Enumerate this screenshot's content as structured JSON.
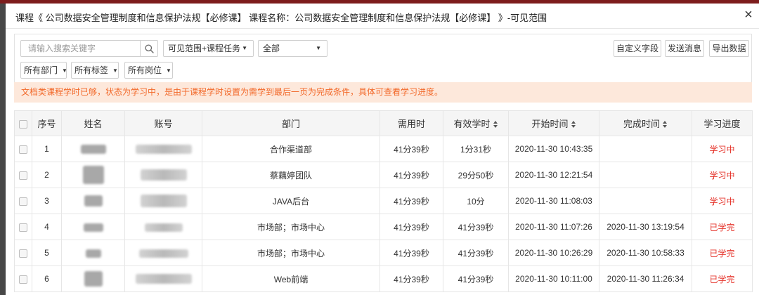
{
  "dialog": {
    "title": "课程《 公司数据安全管理制度和信息保护法规【必修课】 课程名称：公司数据安全管理制度和信息保护法规【必修课】 》-可见范围",
    "close_glyph": "×"
  },
  "filters": {
    "search": {
      "placeholder": "请输入搜索关键字",
      "value": ""
    },
    "scope_select": "可见范围+课程任务",
    "status_select": "全部",
    "department_select": "所有部门",
    "tag_select": "所有标签",
    "position_select": "所有岗位",
    "caret_glyph": "▼"
  },
  "actions": {
    "custom_fields": "自定义字段",
    "send_message": "发送消息",
    "export": "导出数据"
  },
  "notice": "文档类课程学时已够，状态为学习中，是由于课程学时设置为需学到最后一页为完成条件，具体可查看学习进度。",
  "table": {
    "select_all": false,
    "columns": [
      {
        "label": "序号",
        "sortable": false
      },
      {
        "label": "姓名",
        "sortable": false
      },
      {
        "label": "账号",
        "sortable": false
      },
      {
        "label": "部门",
        "sortable": false
      },
      {
        "label": "需用时",
        "sortable": false
      },
      {
        "label": "有效学时",
        "sortable": true
      },
      {
        "label": "开始时间",
        "sortable": true
      },
      {
        "label": "完成时间",
        "sortable": true
      },
      {
        "label": "学习进度",
        "sortable": false
      }
    ],
    "rows": [
      {
        "checked": false,
        "seq": "1",
        "dept": "合作渠道部",
        "required_time": "41分39秒",
        "effective_time": "1分31秒",
        "start_time": "2020-11-30 10:43:35",
        "finish_time": "",
        "progress": "学习中"
      },
      {
        "checked": false,
        "seq": "2",
        "dept": "蔡藕婷团队",
        "required_time": "41分39秒",
        "effective_time": "29分50秒",
        "start_time": "2020-11-30 12:21:54",
        "finish_time": "",
        "progress": "学习中"
      },
      {
        "checked": false,
        "seq": "3",
        "dept": "JAVA后台",
        "required_time": "41分39秒",
        "effective_time": "10分",
        "start_time": "2020-11-30 11:08:03",
        "finish_time": "",
        "progress": "学习中"
      },
      {
        "checked": false,
        "seq": "4",
        "dept": "市场部；市场中心",
        "required_time": "41分39秒",
        "effective_time": "41分39秒",
        "start_time": "2020-11-30 11:07:26",
        "finish_time": "2020-11-30 13:19:54",
        "progress": "已学完"
      },
      {
        "checked": false,
        "seq": "5",
        "dept": "市场部；市场中心",
        "required_time": "41分39秒",
        "effective_time": "41分39秒",
        "start_time": "2020-11-30 10:26:29",
        "finish_time": "2020-11-30 10:58:33",
        "progress": "已学完"
      },
      {
        "checked": false,
        "seq": "6",
        "dept": "Web前端",
        "required_time": "41分39秒",
        "effective_time": "41分39秒",
        "start_time": "2020-11-30 10:11:00",
        "finish_time": "2020-11-30 11:26:34",
        "progress": "已学完"
      }
    ]
  },
  "icons": {
    "close": "close-icon",
    "search": "search-icon",
    "dropdown": "caret-down-icon",
    "sort": "sort-icon",
    "checkbox": "checkbox-icon"
  },
  "colors": {
    "top_strip": "#7d1d1d",
    "notice_bg": "#fde8db",
    "notice_text": "#f2692a",
    "status_text": "#e5332a",
    "header_bg": "#f5f5f5"
  }
}
